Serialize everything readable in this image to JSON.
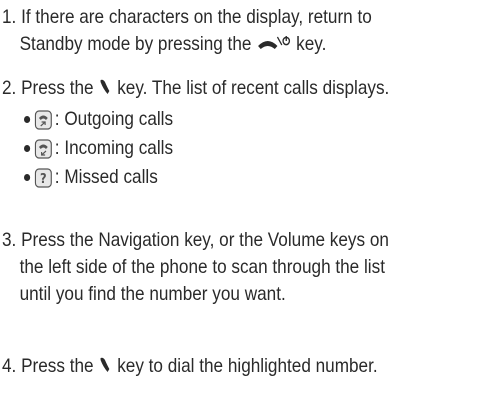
{
  "steps": [
    {
      "number": "1.",
      "text_line1_before_key": "If there are characters on the display, return to",
      "text_line2_before_key": "Standby mode by pressing the",
      "key_icon": "end-power-key-icon",
      "text_line2_after_key": "key."
    },
    {
      "number": "2.",
      "text_before_key": "Press the",
      "key_icon": "send-key-icon",
      "text_after_key": "key. The list of recent calls displays.",
      "bullets": [
        {
          "icon": "outgoing-calls-icon",
          "label": ": Outgoing calls"
        },
        {
          "icon": "incoming-calls-icon",
          "label": ": Incoming calls"
        },
        {
          "icon": "missed-calls-icon",
          "label": ": Missed calls"
        }
      ]
    },
    {
      "number": "3.",
      "line1": "Press the Navigation key, or the Volume keys on",
      "line2": "the left side of the phone to scan through the list",
      "line3": "until you find the number you want."
    },
    {
      "number": "4.",
      "text_before_key": "Press the",
      "key_icon": "send-key-icon",
      "text_after_key": "key to dial the highlighted number."
    }
  ],
  "colors": {
    "text": "#2a2a2a",
    "icon_stroke": "#555555",
    "icon_fill": "#e8e8e8"
  }
}
